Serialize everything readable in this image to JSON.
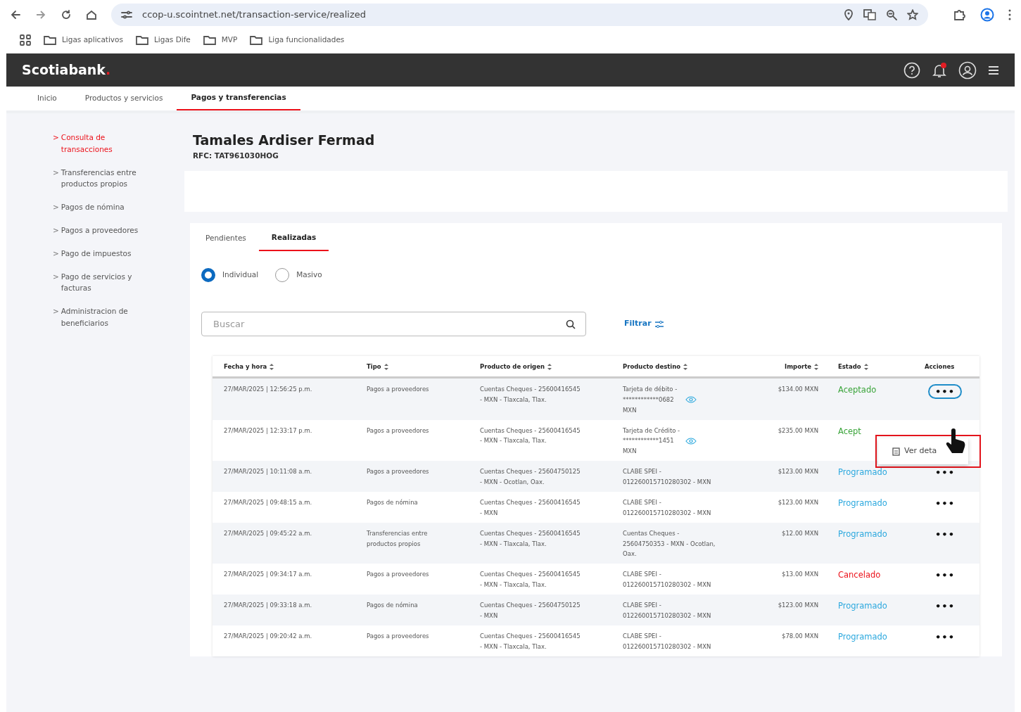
{
  "browser": {
    "url": "ccop-u.scointnet.net/transaction-service/realized",
    "bookmarks": [
      "Ligas aplicativos",
      "Ligas Dife",
      "MVP",
      "Liga funcionalidades"
    ]
  },
  "header": {
    "logo": "Scotiabank",
    "logo_dot": ".",
    "notification": true
  },
  "top_nav": [
    {
      "label": "Inicio",
      "selected": false
    },
    {
      "label": "Productos y servicios",
      "selected": false
    },
    {
      "label": "Pagos y transferencias",
      "selected": true
    }
  ],
  "sidebar": {
    "marker": ">",
    "items": [
      {
        "label": "Consulta de transacciones",
        "selected": true
      },
      {
        "label": "Transferencias entre productos propios",
        "selected": false
      },
      {
        "label": "Pagos de nómina",
        "selected": false
      },
      {
        "label": "Pagos a proveedores",
        "selected": false
      },
      {
        "label": "Pago de impuestos",
        "selected": false
      },
      {
        "label": "Pago de servicios y facturas",
        "selected": false
      },
      {
        "label": "Administracion de beneficiarios",
        "selected": false
      }
    ]
  },
  "company": {
    "name": "Tamales Ardiser Fermad",
    "rfc": "RFC: TAT961030HOG"
  },
  "tabs": [
    {
      "label": "Pendientes",
      "selected": false
    },
    {
      "label": "Realizadas",
      "selected": true
    }
  ],
  "radios": [
    {
      "label": "Individual",
      "selected": true
    },
    {
      "label": "Masivo",
      "selected": false
    }
  ],
  "search": {
    "placeholder": "Buscar"
  },
  "filter": {
    "label": "Filtrar"
  },
  "table": {
    "columns": [
      {
        "label": "Fecha y hora",
        "sortable": true
      },
      {
        "label": "Tipo",
        "sortable": true
      },
      {
        "label": "Producto de origen",
        "sortable": true
      },
      {
        "label": "Producto destino",
        "sortable": true
      },
      {
        "label": "Importe",
        "sortable": true
      },
      {
        "label": "Estado",
        "sortable": true
      },
      {
        "label": "Acciones",
        "sortable": false
      }
    ],
    "rows": [
      {
        "date": "27/MAR/2025 | 12:56:25 p.m.",
        "type": "Pagos a proveedores",
        "origin": "Cuentas Cheques - 25600416545 - MXN - Tlaxcala, Tlax.",
        "destination": [
          "Tarjeta de débito -",
          "************0682",
          "MXN"
        ],
        "masked": true,
        "amount": "$134.00 MXN",
        "status": {
          "label": "Aceptado",
          "kind": "accepted"
        },
        "actions": {
          "label": "•••",
          "open": true
        }
      },
      {
        "date": "27/MAR/2025 | 12:33:17 p.m.",
        "type": "Pagos a proveedores",
        "origin": "Cuentas Cheques - 25600416545 - MXN - Tlaxcala, Tlax.",
        "destination": [
          "Tarjeta de Crédito -",
          "************1451",
          "MXN"
        ],
        "masked": true,
        "amount": "$235.00 MXN",
        "status": {
          "label": "Acept",
          "kind": "accepted"
        }
      },
      {
        "date": "27/MAR/2025 | 10:11:08 a.m.",
        "type": "Pagos a proveedores",
        "origin": "Cuentas Cheques - 25604750125 - MXN - Ocotlan, Oax.",
        "destination": [
          "CLABE SPEI -",
          "012260015710280302 - MXN"
        ],
        "masked": false,
        "amount": "$123.00 MXN",
        "status": {
          "label": "Programado",
          "kind": "scheduled"
        },
        "actions": {
          "label": "•••",
          "open": false
        }
      },
      {
        "date": "27/MAR/2025 | 09:48:15 a.m.",
        "type": "Pagos de nómina",
        "origin": "Cuentas Cheques - 25600416545 - MXN",
        "destination": [
          "CLABE SPEI -",
          "012260015710280302 - MXN"
        ],
        "masked": false,
        "amount": "$123.00 MXN",
        "status": {
          "label": "Programado",
          "kind": "scheduled"
        },
        "actions": {
          "label": "•••",
          "open": false
        }
      },
      {
        "date": "27/MAR/2025 | 09:45:22 a.m.",
        "type": "Transferencias entre productos propios",
        "origin": "Cuentas Cheques - 25600416545 - MXN - Tlaxcala, Tlax.",
        "destination": [
          "Cuentas Cheques -",
          "25604750353 - MXN - Ocotlan, Oax."
        ],
        "masked": false,
        "amount": "$12.00 MXN",
        "status": {
          "label": "Programado",
          "kind": "scheduled"
        },
        "actions": {
          "label": "•••",
          "open": false
        }
      },
      {
        "date": "27/MAR/2025 | 09:34:17 a.m.",
        "type": "Pagos a proveedores",
        "origin": "Cuentas Cheques - 25600416545 - MXN - Tlaxcala, Tlax.",
        "destination": [
          "CLABE SPEI -",
          "012260015710280302 - MXN"
        ],
        "masked": false,
        "amount": "$13.00 MXN",
        "status": {
          "label": "Cancelado",
          "kind": "cancelled"
        },
        "actions": {
          "label": "•••",
          "open": false
        }
      },
      {
        "date": "27/MAR/2025 | 09:33:18 a.m.",
        "type": "Pagos de nómina",
        "origin": "Cuentas Cheques - 25604750125 - MXN",
        "destination": [
          "CLABE SPEI -",
          "012260015710280302 - MXN"
        ],
        "masked": false,
        "amount": "$123.00 MXN",
        "status": {
          "label": "Programado",
          "kind": "scheduled"
        },
        "actions": {
          "label": "•••",
          "open": false
        }
      },
      {
        "date": "27/MAR/2025 | 09:20:42 a.m.",
        "type": "Pagos a proveedores",
        "origin": "Cuentas Cheques - 25600416545 - MXN - Tlaxcala, Tlax.",
        "destination": [
          "CLABE SPEI -",
          "012260015710280302 - MXN"
        ],
        "masked": false,
        "amount": "$78.00 MXN",
        "status": {
          "label": "Programado",
          "kind": "scheduled"
        },
        "actions": {
          "label": "•••",
          "open": false
        }
      }
    ]
  },
  "action_menu": {
    "item": "Ver deta",
    "highlighted": true
  }
}
